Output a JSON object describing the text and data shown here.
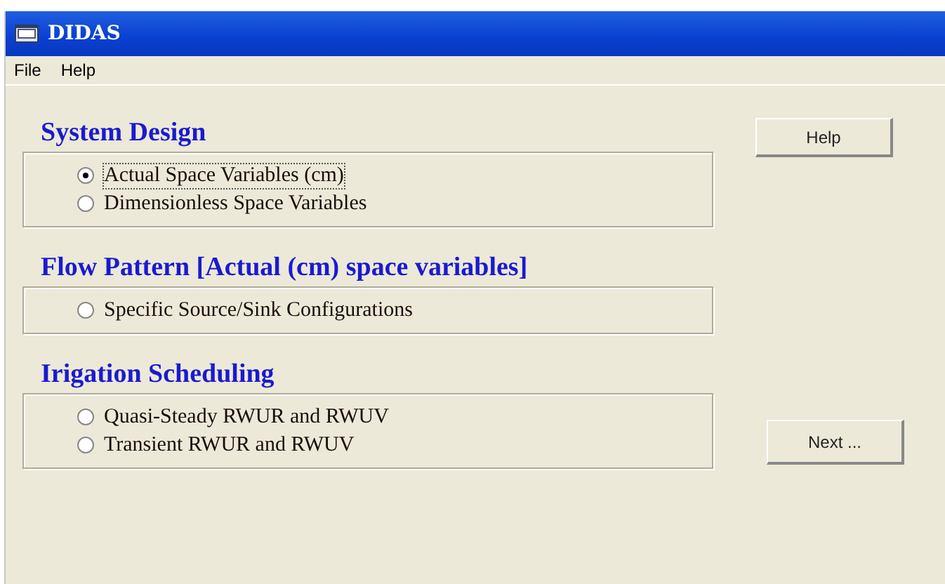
{
  "window": {
    "title": "DIDAS"
  },
  "menu": [
    "File",
    "Help"
  ],
  "sections": [
    {
      "heading": "System Design",
      "options": [
        {
          "label": "Actual Space Variables (cm)",
          "selected": true,
          "focused": true
        },
        {
          "label": "Dimensionless Space Variables",
          "selected": false,
          "focused": false
        }
      ],
      "button": "Help"
    },
    {
      "heading": "Flow Pattern  [Actual (cm) space variables]",
      "options": [
        {
          "label": "Specific Source/Sink Configurations",
          "selected": false,
          "focused": false
        }
      ]
    },
    {
      "heading": "Irigation Scheduling",
      "options": [
        {
          "label": "Quasi-Steady RWUR and RWUV",
          "selected": false,
          "focused": false
        },
        {
          "label": "Transient RWUR and RWUV",
          "selected": false,
          "focused": false
        }
      ],
      "button": "Next ..."
    }
  ]
}
